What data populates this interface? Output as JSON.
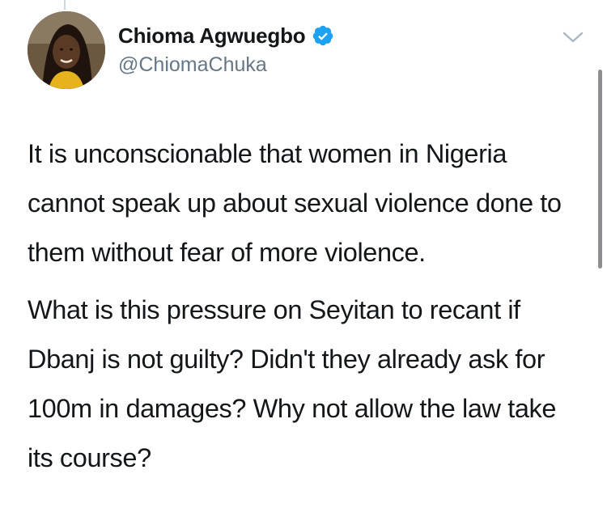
{
  "tweet": {
    "author": {
      "display_name": "Chioma Agwuegbo",
      "handle": "@ChiomaChuka",
      "verified": true,
      "avatar_icon": "profile-photo"
    },
    "menu_icon": "chevron-down-icon",
    "paragraphs": [
      "It is unconscionable that women in Nigeria cannot speak up about sexual violence done to them without fear of more violence.",
      "What is this pressure on Seyitan to recant if Dbanj is not guilty? Didn't they already ask for 100m in damages? Why not allow the law take its course?"
    ]
  },
  "colors": {
    "text": "#14171a",
    "secondary_text": "#657786",
    "verified_badge": "#1da1f2",
    "chevron": "#aab8c2"
  }
}
